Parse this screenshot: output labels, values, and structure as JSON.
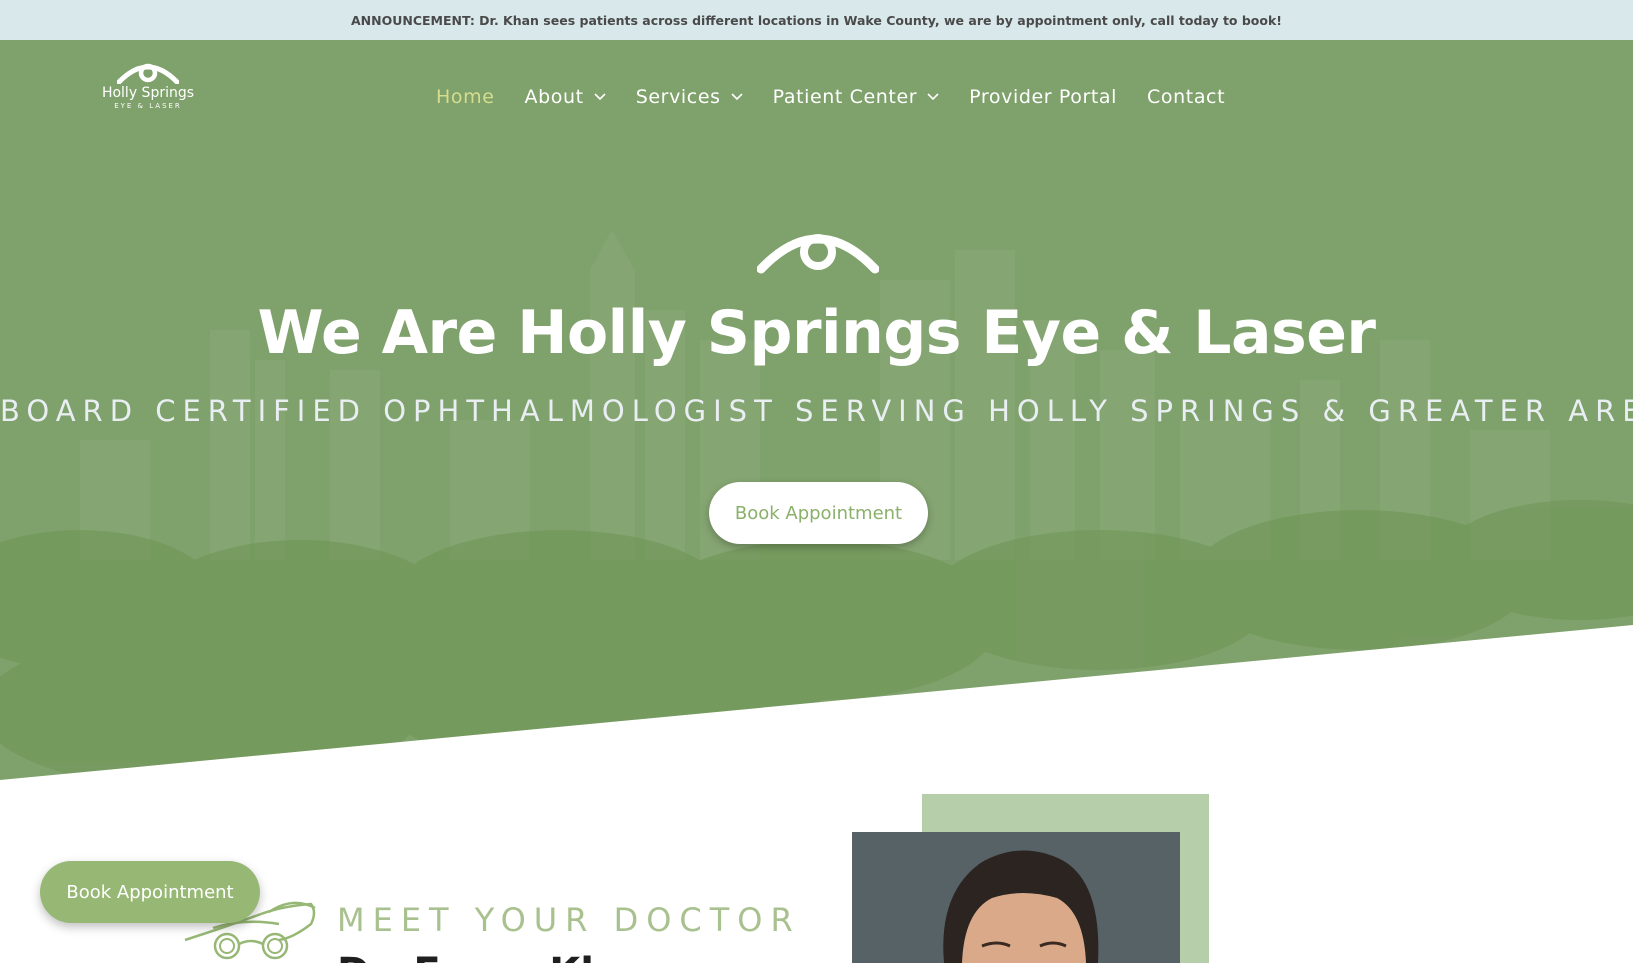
{
  "announcement": {
    "text": "ANNOUNCEMENT: Dr. Khan sees patients across different locations in Wake County, we are by appointment only, call today to book!"
  },
  "logo": {
    "name": "Holly Springs",
    "sub": "EYE & LASER",
    "icon": "eye-icon"
  },
  "nav": {
    "items": [
      {
        "label": "Home",
        "active": true
      },
      {
        "label": "About",
        "dropdown": true
      },
      {
        "label": "Services",
        "dropdown": true
      },
      {
        "label": "Patient Center",
        "dropdown": true
      },
      {
        "label": "Provider Portal"
      },
      {
        "label": "Contact"
      }
    ]
  },
  "hero": {
    "title": "We Are Holly Springs Eye & Laser",
    "subtitle": "BOARD CERTIFIED OPHTHALMOLOGIST SERVING HOLLY SPRINGS & GREATER AREA",
    "button_label": "Book Appointment",
    "icon": "eye-icon"
  },
  "doctor": {
    "eyebrow": "MEET YOUR DOCTOR",
    "name": "Dr. Faraz Khan",
    "icon": "glasses-icon"
  },
  "floating": {
    "button_label": "Book Appointment"
  },
  "colors": {
    "accent_green": "#97b874",
    "hero_overlay": "#7ea06a",
    "announcement_bg": "#d9e8ea",
    "active_nav": "#d6dd8e",
    "doctor_frame": "#b6ceaa"
  }
}
